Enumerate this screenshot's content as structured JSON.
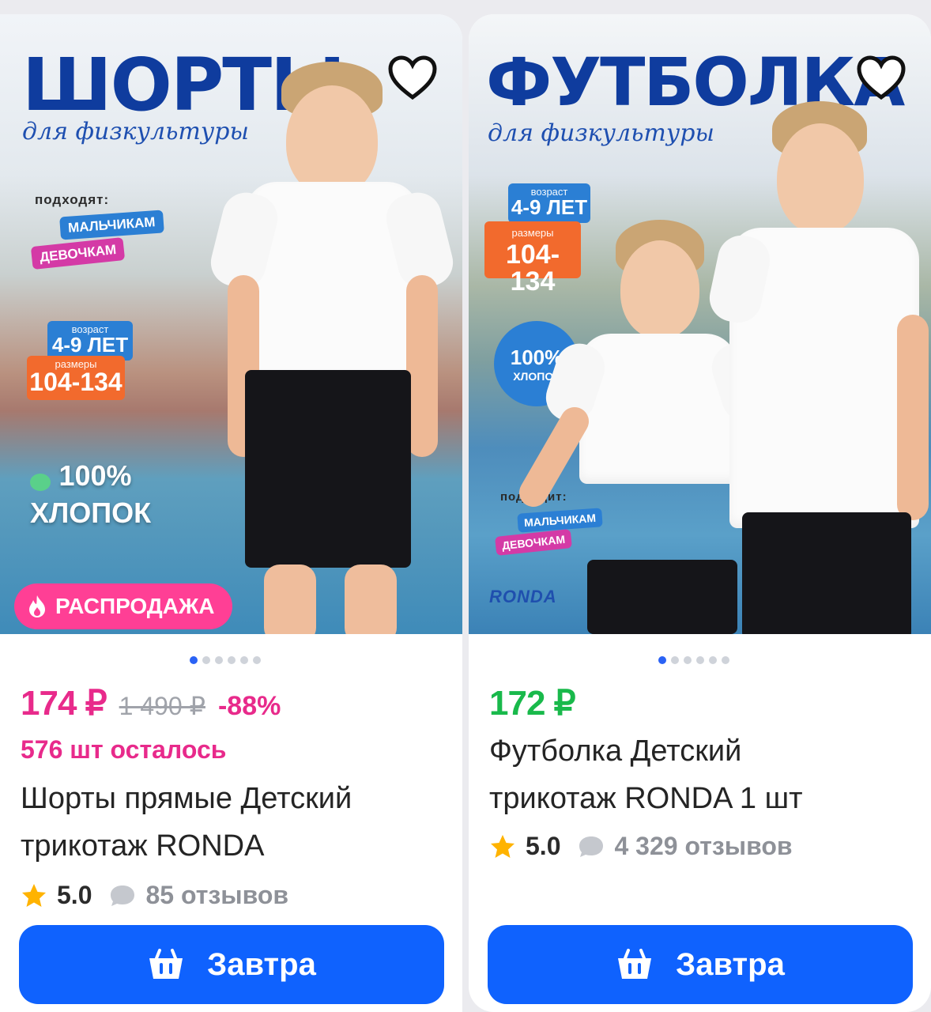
{
  "cards": [
    {
      "banner": {
        "title": "ШОРТЫ",
        "subtitle": "для физкультуры",
        "fits_label": "подходят:",
        "tag_boys": "МАЛЬЧИКАМ",
        "tag_girls": "ДЕВОЧКАМ",
        "age_caption": "возраст",
        "age_value": "4-9 ЛЕТ",
        "sizes_caption": "размеры",
        "sizes_value": "104-134",
        "cotton_percent": "100%",
        "cotton_label": "ХЛОПОК",
        "sale_badge": "РАСПРОДАЖА"
      },
      "carousel": {
        "count": 6,
        "active": 0
      },
      "price": "174 ₽",
      "old_price": "1 490 ₽",
      "discount": "-88%",
      "stock": "576 шт осталось",
      "name_line1": "Шорты прямые Детский",
      "name_line2": "трикотаж RONDA",
      "rating": "5.0",
      "reviews": "85 отзывов",
      "button_label": "Завтра"
    },
    {
      "banner": {
        "title": "ФУТБОЛКА",
        "subtitle": "для физкультуры",
        "age_caption": "возраст",
        "age_value": "4-9 ЛЕТ",
        "sizes_caption": "размеры",
        "sizes_value": "104-134",
        "cotton_percent": "100%",
        "cotton_label": "ХЛОПОК",
        "fits_label": "подходит:",
        "tag_boys": "МАЛЬЧИКАМ",
        "tag_girls": "ДЕВОЧКАМ",
        "brand": "RONDA"
      },
      "carousel": {
        "count": 6,
        "active": 0
      },
      "price": "172 ₽",
      "name_line1": "Футболка Детский",
      "name_line2": "трикотаж RONDA 1 шт",
      "rating": "5.0",
      "reviews": "4 329 отзывов",
      "button_label": "Завтра"
    }
  ],
  "colors": {
    "accent": "#0f62fe",
    "sale_pink": "#e82a8b",
    "price_green": "#19b94b",
    "title_blue": "#0f3c9e"
  },
  "icons": [
    "heart-icon",
    "flame-icon",
    "star-icon",
    "comment-bubble-icon",
    "basket-icon"
  ]
}
